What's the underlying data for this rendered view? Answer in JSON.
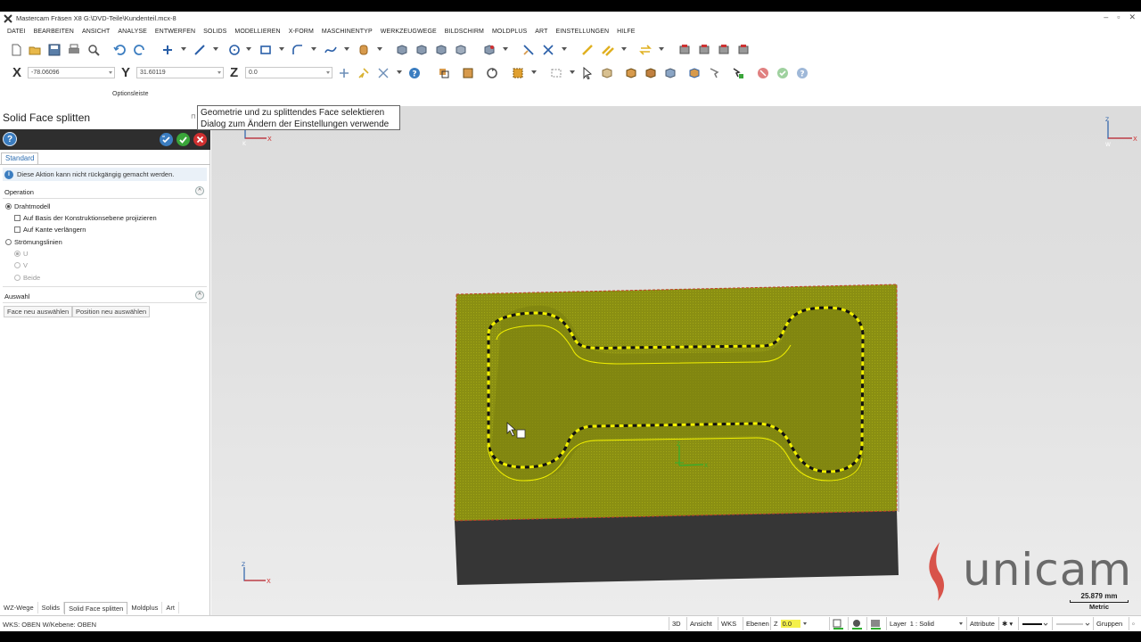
{
  "window": {
    "title": "Mastercam Fräsen X8  G:\\DVD-Teile\\Kundenteil.mcx-8",
    "controls": [
      "–",
      "▫",
      "✕"
    ]
  },
  "menu": [
    "DATEI",
    "BEARBEITEN",
    "ANSICHT",
    "ANALYSE",
    "ENTWERFEN",
    "SOLIDS",
    "MODELLIEREN",
    "X-FORM",
    "MASCHINENTYP",
    "WERKZEUGWEGE",
    "BILDSCHIRM",
    "MOLDPLUS",
    "ART",
    "EINSTELLUNGEN",
    "HILFE"
  ],
  "coords": {
    "x_label": "X",
    "x_value": "-78.06096",
    "y_label": "Y",
    "y_value": "31.60119",
    "z_label": "Z",
    "z_value": "0.0"
  },
  "options_bar_label": "Optionsleiste",
  "tooltip": {
    "line1": "Geometrie und zu splittendes Face selektieren",
    "line2": "Dialog zum Ändern der Einstellungen verwende"
  },
  "panel": {
    "title": "Solid Face splitten",
    "pin": "⊓",
    "help": "?",
    "tab": "Standard",
    "info": "Diese Aktion kann nicht rückgängig gemacht werden.",
    "operation": {
      "heading": "Operation",
      "drahtmodell": "Drahtmodell",
      "projizieren": "Auf Basis der Konstruktionsebene projizieren",
      "verlaengern": "Auf Kante verlängern",
      "stroemung": "Strömungslinien",
      "u": "U",
      "v": "V",
      "beide": "Beide"
    },
    "auswahl": {
      "heading": "Auswahl",
      "face_btn": "Face neu auswählen",
      "pos_btn": "Position neu auswählen"
    }
  },
  "bottom_tabs": [
    "WZ-Wege",
    "Solids",
    "Solid Face splitten",
    "Moldplus",
    "Art"
  ],
  "viewport": {
    "axis_x": "X",
    "axis_y": "Y",
    "axis_z": "Z",
    "axis_w": "W",
    "axis_k": "K"
  },
  "logo": {
    "text": "unicam"
  },
  "scale": {
    "value": "25.879 mm",
    "unit": "Metric"
  },
  "status": {
    "left": "WKS: OBEN  W/Kebene: OBEN",
    "btn_3d": "3D",
    "ansicht": "Ansicht",
    "wks": "WKS",
    "ebenen": "Ebenen",
    "z_label": "Z",
    "z_value": "0.0",
    "layer_label": "Layer",
    "layer_value": "1 : Solid",
    "attribute": "Attribute",
    "gruppen": "Gruppen"
  },
  "colors": {
    "face": "#8a8f12",
    "face_hatch": "#a0a615",
    "side": "#363636",
    "dash_yellow": "#f2f000",
    "accent_blue": "#3b7dc0",
    "ok_green": "#3aa53a",
    "cancel_red": "#d03030"
  }
}
